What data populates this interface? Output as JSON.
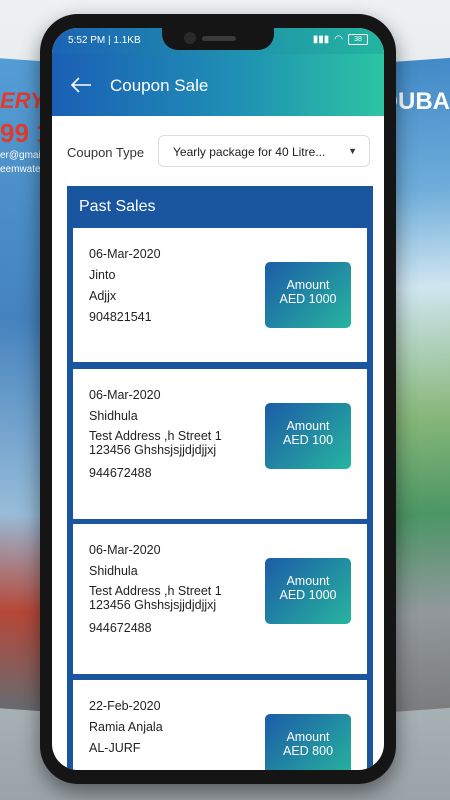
{
  "background": {
    "left_text_1": "ERY",
    "left_text_2": "99 1",
    "left_text_3": "er@gmai",
    "left_text_4": "eemwate",
    "right_text": "DUBA"
  },
  "status_bar": {
    "time": "5:52 PM | 1.1KB",
    "battery": "38"
  },
  "app_bar": {
    "title": "Coupon Sale"
  },
  "filter": {
    "label": "Coupon Type",
    "selected": "Yearly package for 40 Litre..."
  },
  "panel": {
    "title": "Past Sales"
  },
  "sales": [
    {
      "date": "06-Mar-2020",
      "name": "Jinto",
      "address": "Adjjx",
      "phone": "904821541",
      "amount_label": "Amount",
      "amount": "AED 1000"
    },
    {
      "date": "06-Mar-2020",
      "name": "Shidhula",
      "address": "Test Address ,h Street 1 123456 Ghshsjsjjdjdjjxj",
      "phone": "944672488",
      "amount_label": "Amount",
      "amount": "AED 100"
    },
    {
      "date": "06-Mar-2020",
      "name": "Shidhula",
      "address": "Test Address ,h Street 1 123456 Ghshsjsjjdjdjjxj",
      "phone": "944672488",
      "amount_label": "Amount",
      "amount": "AED 1000"
    },
    {
      "date": "22-Feb-2020",
      "name": "Ramia Anjala",
      "address": "AL-JURF",
      "phone": "",
      "amount_label": "Amount",
      "amount": "AED 800"
    }
  ],
  "colors": {
    "header_start": "#1b5fb5",
    "header_end": "#2cc4a3",
    "panel": "#1a56a0"
  }
}
